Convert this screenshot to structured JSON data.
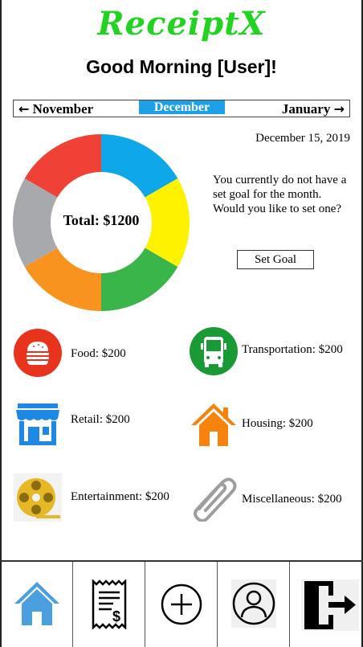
{
  "app": {
    "title": "ReceiptX"
  },
  "greeting": "Good Morning [User]!",
  "months": {
    "prev": "November",
    "current": "December",
    "next": "January"
  },
  "date": "December 15, 2019",
  "summary": {
    "total": "Total: $1200"
  },
  "goal": {
    "message": "You currently do not have a set goal for the month. Would you like to set one?",
    "button_label": "Set Goal"
  },
  "chart_data": {
    "type": "pie",
    "categories": [
      "Transportation",
      "Miscellaneous",
      "Housing",
      "Retail",
      "Entertainment",
      "Food"
    ],
    "values": [
      200,
      200,
      200,
      200,
      200,
      200
    ],
    "colors": [
      "#0ea7e8",
      "#fff200",
      "#3ab54a",
      "#f7931e",
      "#a7a9ac",
      "#ef4136"
    ]
  },
  "categories": [
    {
      "label": "Food: $200",
      "icon": "burger-icon",
      "color": "#e8341c"
    },
    {
      "label": "Transportation: $200",
      "icon": "bus-icon",
      "color": "#1a9a34"
    },
    {
      "label": "Retail: $200",
      "icon": "storefront-icon",
      "color": "#1e88e5"
    },
    {
      "label": "Housing: $200",
      "icon": "house-icon",
      "color": "#f7820d"
    },
    {
      "label": "Entertainment: $200",
      "icon": "film-reel-icon",
      "color": "#e7b826"
    },
    {
      "label": "Miscellaneous: $200",
      "icon": "paperclip-icon",
      "color": "#9e9e9e"
    }
  ],
  "nav": [
    {
      "name": "home",
      "icon": "home-icon"
    },
    {
      "name": "receipts",
      "icon": "receipt-icon"
    },
    {
      "name": "add",
      "icon": "add-icon"
    },
    {
      "name": "profile",
      "icon": "profile-icon"
    },
    {
      "name": "logout",
      "icon": "logout-icon"
    }
  ]
}
